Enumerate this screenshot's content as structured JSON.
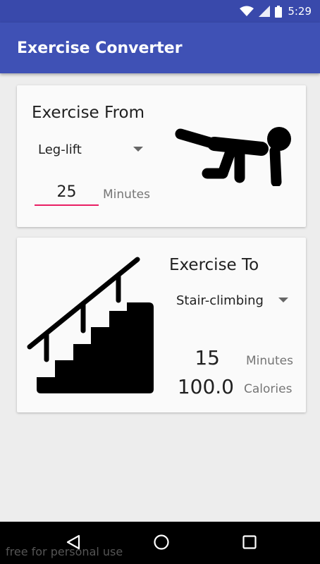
{
  "status_bar": {
    "time": "5:29"
  },
  "app_bar": {
    "title": "Exercise Converter"
  },
  "exercise_from": {
    "title": "Exercise From",
    "selected_exercise": "Leg-lift",
    "minutes_value": "25",
    "minutes_unit": "Minutes"
  },
  "exercise_to": {
    "title": "Exercise To",
    "selected_exercise": "Stair-climbing",
    "minutes_value": "15",
    "minutes_unit": "Minutes",
    "calories_value": "100.0",
    "calories_unit": "Calories"
  },
  "watermark": "free for personal use",
  "colors": {
    "primary": "#3f51b5",
    "primary_dark": "#3949ab",
    "accent": "#e91e63"
  }
}
